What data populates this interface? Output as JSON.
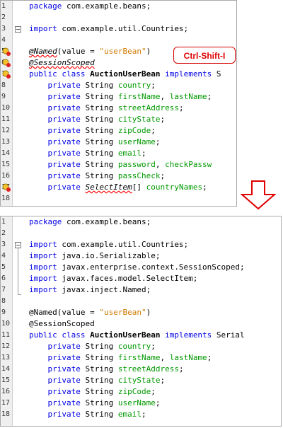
{
  "callout": {
    "text": "Ctrl-Shift-I"
  },
  "colors": {
    "keyword": "#0000e6",
    "string": "#ce7b00",
    "field": "#009900",
    "error": "#ff0000",
    "callout": "#e00000"
  },
  "top_panel": {
    "lines": [
      {
        "n": "1",
        "tokens": [
          {
            "t": "package",
            "c": "kw"
          },
          {
            "t": " com.example.beans;"
          }
        ]
      },
      {
        "n": "2",
        "tokens": []
      },
      {
        "n": "3",
        "tokens": [
          {
            "t": "import",
            "c": "kw"
          },
          {
            "t": " com.example.util.Countries;"
          }
        ]
      },
      {
        "n": "4",
        "tokens": []
      },
      {
        "n": "5",
        "tokens": [
          {
            "t": "@Named",
            "c": "ann err italic"
          },
          {
            "t": "(value = "
          },
          {
            "t": "\"userBean\"",
            "c": "str"
          },
          {
            "t": ")"
          }
        ]
      },
      {
        "n": "6",
        "tokens": [
          {
            "t": "@SessionScoped",
            "c": "ann err italic"
          }
        ]
      },
      {
        "n": "7",
        "tokens": [
          {
            "t": "public class",
            "c": "kw"
          },
          {
            "t": " "
          },
          {
            "t": "AuctionUserBean",
            "c": "bold"
          },
          {
            "t": " "
          },
          {
            "t": "implements",
            "c": "kw"
          },
          {
            "t": " S"
          }
        ]
      },
      {
        "n": "8",
        "tokens": [
          {
            "t": "    private",
            "c": "kw"
          },
          {
            "t": " String "
          },
          {
            "t": "country",
            "c": "fld"
          },
          {
            "t": ";"
          }
        ]
      },
      {
        "n": "9",
        "tokens": [
          {
            "t": "    private",
            "c": "kw"
          },
          {
            "t": " String "
          },
          {
            "t": "firstName",
            "c": "fld"
          },
          {
            "t": ", "
          },
          {
            "t": "lastName",
            "c": "fld"
          },
          {
            "t": ";"
          }
        ]
      },
      {
        "n": "10",
        "tokens": [
          {
            "t": "    private",
            "c": "kw"
          },
          {
            "t": " String "
          },
          {
            "t": "streetAddress",
            "c": "fld"
          },
          {
            "t": ";"
          }
        ]
      },
      {
        "n": "11",
        "tokens": [
          {
            "t": "    private",
            "c": "kw"
          },
          {
            "t": " String "
          },
          {
            "t": "cityState",
            "c": "fld"
          },
          {
            "t": ";"
          }
        ]
      },
      {
        "n": "12",
        "tokens": [
          {
            "t": "    private",
            "c": "kw"
          },
          {
            "t": " String "
          },
          {
            "t": "zipCode",
            "c": "fld"
          },
          {
            "t": ";"
          }
        ]
      },
      {
        "n": "13",
        "tokens": [
          {
            "t": "    private",
            "c": "kw"
          },
          {
            "t": " String "
          },
          {
            "t": "userName",
            "c": "fld"
          },
          {
            "t": ";"
          }
        ]
      },
      {
        "n": "14",
        "tokens": [
          {
            "t": "    private",
            "c": "kw"
          },
          {
            "t": " String "
          },
          {
            "t": "email",
            "c": "fld"
          },
          {
            "t": ";"
          }
        ]
      },
      {
        "n": "15",
        "tokens": [
          {
            "t": "    private",
            "c": "kw"
          },
          {
            "t": " String "
          },
          {
            "t": "password",
            "c": "fld"
          },
          {
            "t": ", "
          },
          {
            "t": "checkPassw",
            "c": "fld"
          }
        ]
      },
      {
        "n": "16",
        "tokens": [
          {
            "t": "    private",
            "c": "kw"
          },
          {
            "t": " String "
          },
          {
            "t": "passCheck",
            "c": "fld"
          },
          {
            "t": ";"
          }
        ]
      },
      {
        "n": "17",
        "tokens": [
          {
            "t": "    private",
            "c": "kw"
          },
          {
            "t": " "
          },
          {
            "t": "SelectItem",
            "c": "err italic"
          },
          {
            "t": "[] "
          },
          {
            "t": "countryNames",
            "c": "fld"
          },
          {
            "t": ";"
          }
        ]
      },
      {
        "n": "18",
        "tokens": []
      }
    ]
  },
  "bottom_panel": {
    "lines": [
      {
        "n": "1",
        "tokens": [
          {
            "t": "package",
            "c": "kw"
          },
          {
            "t": " com.example.beans;"
          }
        ]
      },
      {
        "n": "2",
        "tokens": []
      },
      {
        "n": "3",
        "tokens": [
          {
            "t": "import",
            "c": "kw"
          },
          {
            "t": " com.example.util.Countries;"
          }
        ]
      },
      {
        "n": "4",
        "tokens": [
          {
            "t": "import",
            "c": "kw"
          },
          {
            "t": " java.io.Serializable;"
          }
        ]
      },
      {
        "n": "5",
        "tokens": [
          {
            "t": "import",
            "c": "kw"
          },
          {
            "t": " javax.enterprise.context.SessionScoped;"
          }
        ]
      },
      {
        "n": "6",
        "tokens": [
          {
            "t": "import",
            "c": "kw"
          },
          {
            "t": " javax.faces.model.SelectItem;"
          }
        ]
      },
      {
        "n": "7",
        "tokens": [
          {
            "t": "import",
            "c": "kw"
          },
          {
            "t": " javax.inject.Named;"
          }
        ]
      },
      {
        "n": "8",
        "tokens": []
      },
      {
        "n": "9",
        "tokens": [
          {
            "t": "@Named(value = "
          },
          {
            "t": "\"userBean\"",
            "c": "str"
          },
          {
            "t": ")"
          }
        ]
      },
      {
        "n": "10",
        "tokens": [
          {
            "t": "@SessionScoped"
          }
        ]
      },
      {
        "n": "11",
        "tokens": [
          {
            "t": "public class",
            "c": "kw"
          },
          {
            "t": " "
          },
          {
            "t": "AuctionUserBean",
            "c": "bold"
          },
          {
            "t": " "
          },
          {
            "t": "implements",
            "c": "kw"
          },
          {
            "t": " Serial"
          }
        ]
      },
      {
        "n": "12",
        "tokens": [
          {
            "t": "    private",
            "c": "kw"
          },
          {
            "t": " String "
          },
          {
            "t": "country",
            "c": "fld"
          },
          {
            "t": ";"
          }
        ]
      },
      {
        "n": "13",
        "tokens": [
          {
            "t": "    private",
            "c": "kw"
          },
          {
            "t": " String "
          },
          {
            "t": "firstName",
            "c": "fld"
          },
          {
            "t": ", "
          },
          {
            "t": "lastName",
            "c": "fld"
          },
          {
            "t": ";"
          }
        ]
      },
      {
        "n": "14",
        "tokens": [
          {
            "t": "    private",
            "c": "kw"
          },
          {
            "t": " String "
          },
          {
            "t": "streetAddress",
            "c": "fld"
          },
          {
            "t": ";"
          }
        ]
      },
      {
        "n": "15",
        "tokens": [
          {
            "t": "    private",
            "c": "kw"
          },
          {
            "t": " String "
          },
          {
            "t": "cityState",
            "c": "fld"
          },
          {
            "t": ";"
          }
        ]
      },
      {
        "n": "16",
        "tokens": [
          {
            "t": "    private",
            "c": "kw"
          },
          {
            "t": " String "
          },
          {
            "t": "zipCode",
            "c": "fld"
          },
          {
            "t": ";"
          }
        ]
      },
      {
        "n": "17",
        "tokens": [
          {
            "t": "    private",
            "c": "kw"
          },
          {
            "t": " String "
          },
          {
            "t": "userName",
            "c": "fld"
          },
          {
            "t": ";"
          }
        ]
      },
      {
        "n": "18",
        "tokens": [
          {
            "t": "    private",
            "c": "kw"
          },
          {
            "t": " String "
          },
          {
            "t": "email",
            "c": "fld"
          },
          {
            "t": ";"
          }
        ]
      }
    ]
  }
}
